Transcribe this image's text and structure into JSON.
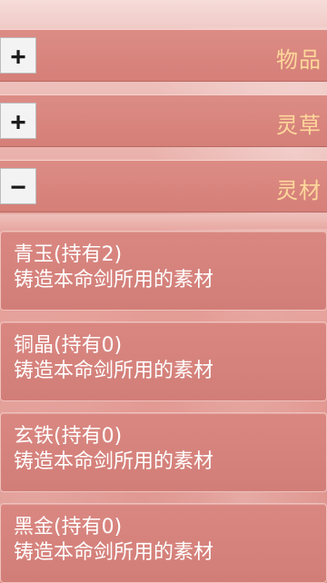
{
  "categories": [
    {
      "toggle": "+",
      "label": "物品"
    },
    {
      "toggle": "+",
      "label": "灵草"
    },
    {
      "toggle": "−",
      "label": "灵材"
    }
  ],
  "items": [
    {
      "name": "青玉(持有2)",
      "desc": "铸造本命剑所用的素材"
    },
    {
      "name": "铜晶(持有0)",
      "desc": "铸造本命剑所用的素材"
    },
    {
      "name": "玄铁(持有0)",
      "desc": "铸造本命剑所用的素材"
    },
    {
      "name": "黑金(持有0)",
      "desc": "铸造本命剑所用的素材"
    }
  ]
}
